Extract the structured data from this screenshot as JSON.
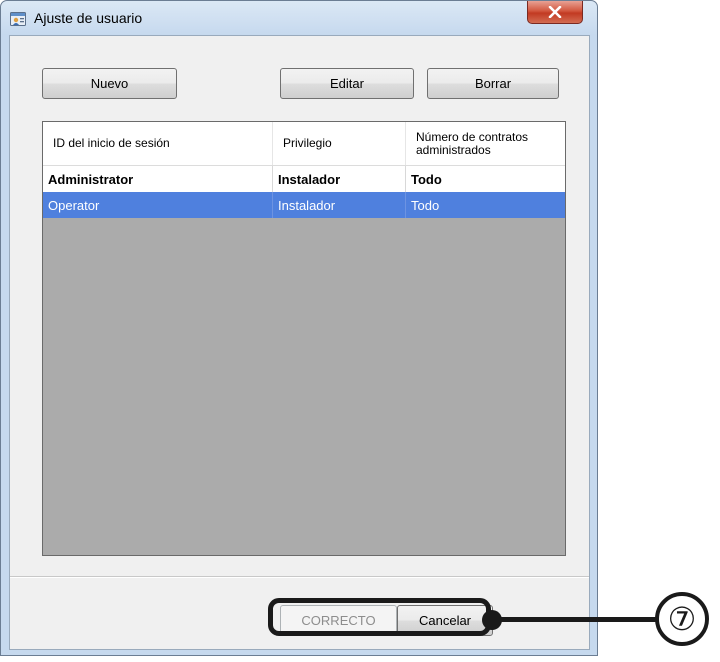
{
  "window": {
    "title": "Ajuste de usuario"
  },
  "toolbar": {
    "new_label": "Nuevo",
    "edit_label": "Editar",
    "delete_label": "Borrar"
  },
  "table": {
    "columns": [
      "ID del inicio de sesión",
      "Privilegio",
      "Número de contratos\nadministrados"
    ],
    "rows": [
      {
        "id": "Administrator",
        "privilege": "Instalador",
        "contracts": "Todo",
        "bold": true,
        "selected": false
      },
      {
        "id": "Operator",
        "privilege": "Instalador",
        "contracts": "Todo",
        "bold": false,
        "selected": true
      }
    ]
  },
  "footer": {
    "ok_label": "CORRECTO",
    "ok_enabled": false,
    "cancel_label": "Cancelar"
  },
  "callout": {
    "number": "⑦"
  },
  "colors": {
    "selection": "#4f80de",
    "grid_background": "#ababab",
    "close_button": "#c23a22"
  }
}
